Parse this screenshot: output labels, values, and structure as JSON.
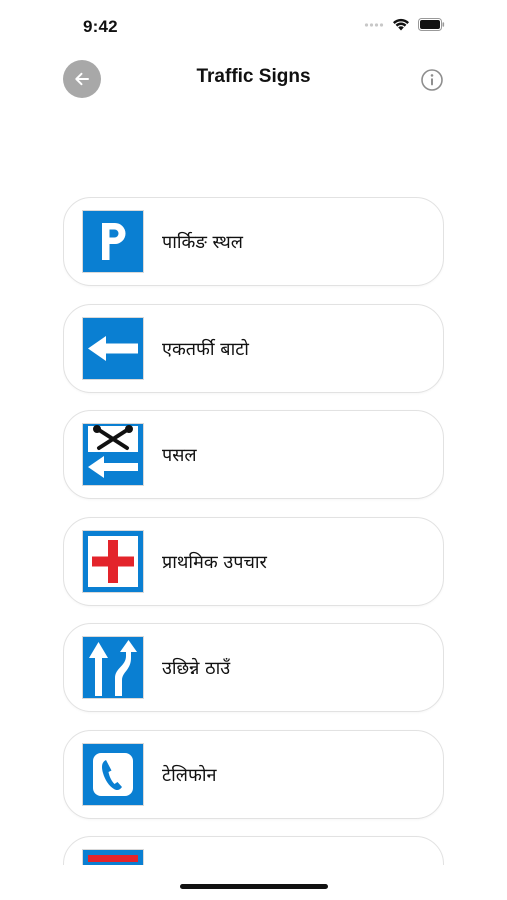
{
  "status_bar": {
    "time": "9:42"
  },
  "nav": {
    "title": "Traffic Signs"
  },
  "signs": [
    {
      "label": "पार्किङ स्थल",
      "icon": "parking-sign-icon"
    },
    {
      "label": "एकतर्फी बाटो",
      "icon": "one-way-sign-icon"
    },
    {
      "label": "पसल",
      "icon": "repair-shop-sign-icon"
    },
    {
      "label": "प्राथमिक उपचार",
      "icon": "first-aid-sign-icon"
    },
    {
      "label": "उछिन्ने ठाउँ",
      "icon": "overtaking-place-sign-icon"
    },
    {
      "label": "टेलिफोन",
      "icon": "telephone-sign-icon"
    },
    {
      "label": "",
      "icon": "partial-sign-icon"
    }
  ],
  "colors": {
    "sign_blue": "#0a7fd2",
    "back_button": "#a8a8a8",
    "red": "#e3242b"
  }
}
